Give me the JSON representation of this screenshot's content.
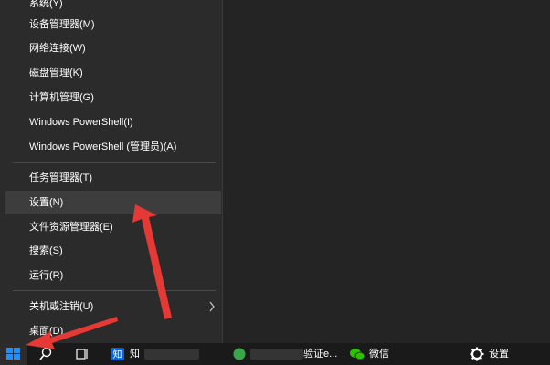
{
  "menu": {
    "items": [
      {
        "label": "系统(Y)"
      },
      {
        "label": "设备管理器(M)"
      },
      {
        "label": "网络连接(W)"
      },
      {
        "label": "磁盘管理(K)"
      },
      {
        "label": "计算机管理(G)"
      },
      {
        "label": "Windows PowerShell(I)"
      },
      {
        "label": "Windows PowerShell (管理员)(A)"
      },
      {
        "label": "任务管理器(T)"
      },
      {
        "label": "设置(N)"
      },
      {
        "label": "文件资源管理器(E)"
      },
      {
        "label": "搜索(S)"
      },
      {
        "label": "运行(R)"
      },
      {
        "label": "关机或注销(U)"
      },
      {
        "label": "桌面(D)"
      }
    ]
  },
  "taskbar": {
    "zhihu_label": "知",
    "verify_label": "验证e...",
    "wechat_label": "微信",
    "settings_label": "设置"
  },
  "colors": {
    "menu_bg": "#2b2b2b",
    "highlight": "#3d3d3d",
    "arrow": "#e53935",
    "start_blue": "#1e90ff",
    "wechat_green": "#2dc100"
  }
}
